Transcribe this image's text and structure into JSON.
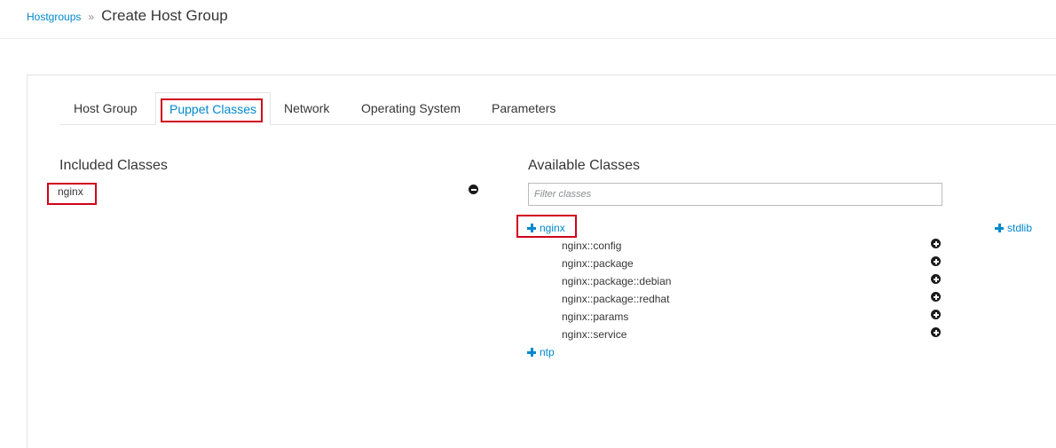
{
  "breadcrumb": {
    "parent": "Hostgroups",
    "separator": "»",
    "current": "Create Host Group"
  },
  "tabs": [
    {
      "label": "Host Group",
      "active": false
    },
    {
      "label": "Puppet Classes",
      "active": true
    },
    {
      "label": "Network",
      "active": false
    },
    {
      "label": "Operating System",
      "active": false
    },
    {
      "label": "Parameters",
      "active": false
    }
  ],
  "included": {
    "title": "Included Classes",
    "items": [
      "nginx"
    ],
    "remove_icon": "minus-circle-icon"
  },
  "available": {
    "title": "Available Classes",
    "filter_placeholder": "Filter classes",
    "groups": [
      {
        "name": "nginx",
        "expanded": true,
        "classes": [
          "nginx::config",
          "nginx::package",
          "nginx::package::debian",
          "nginx::package::redhat",
          "nginx::params",
          "nginx::service"
        ]
      },
      {
        "name": "ntp",
        "expanded": false,
        "classes": []
      },
      {
        "name": "stdlib",
        "expanded": false,
        "classes": []
      }
    ],
    "add_icon": "plus-circle-icon",
    "expand_icon": "plus-icon"
  },
  "colors": {
    "link": "#0088ce",
    "highlight": "#d0021b",
    "text": "#363636"
  }
}
